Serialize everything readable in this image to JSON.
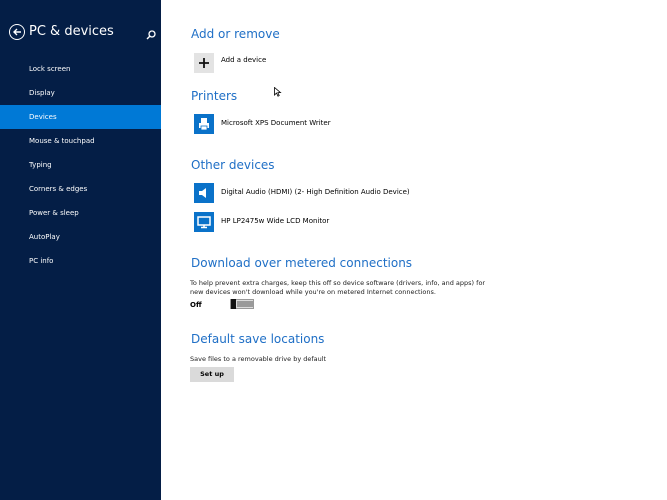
{
  "sidebar": {
    "title": "PC & devices",
    "back_icon": "back-arrow-icon",
    "search_icon": "search-icon",
    "items": [
      {
        "label": "Lock screen",
        "active": false
      },
      {
        "label": "Display",
        "active": false
      },
      {
        "label": "Devices",
        "active": true
      },
      {
        "label": "Mouse & touchpad",
        "active": false
      },
      {
        "label": "Typing",
        "active": false
      },
      {
        "label": "Corners & edges",
        "active": false
      },
      {
        "label": "Power & sleep",
        "active": false
      },
      {
        "label": "AutoPlay",
        "active": false
      },
      {
        "label": "PC info",
        "active": false
      }
    ]
  },
  "main": {
    "add_or_remove": {
      "heading": "Add or remove",
      "add_device_label": "Add a device",
      "add_device_icon": "plus-icon"
    },
    "printers": {
      "heading": "Printers",
      "items": [
        {
          "label": "Microsoft XPS Document Writer",
          "icon": "printer-icon"
        }
      ]
    },
    "other_devices": {
      "heading": "Other devices",
      "items": [
        {
          "label": "Digital Audio (HDMI) (2- High Definition Audio Device)",
          "icon": "speaker-icon"
        },
        {
          "label": "HP LP2475w Wide LCD Monitor",
          "icon": "monitor-icon"
        }
      ]
    },
    "metered": {
      "heading": "Download over metered connections",
      "description": "To help prevent extra charges, keep this off so device software (drivers, info, and apps) for new devices won't download while you're on metered Internet connections.",
      "toggle_state": "Off",
      "toggle_on": false
    },
    "save_locations": {
      "heading": "Default save locations",
      "description": "Save files to a removable drive by default",
      "button_label": "Set up"
    }
  },
  "colors": {
    "sidebar_bg": "#041e46",
    "active_item": "#0079d6",
    "heading": "#1f6fc6",
    "device_icon_bg": "#0a72c9"
  }
}
